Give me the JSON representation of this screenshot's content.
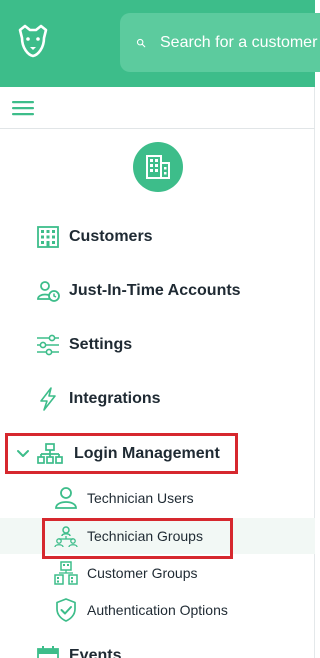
{
  "header": {
    "search_placeholder": "Search for a customer",
    "logo_icon": "cheetah-logo-icon",
    "search_icon": "search-icon"
  },
  "sidebar": {
    "menu_icon": "hamburger-menu-icon",
    "org_icon": "building-icon",
    "items": [
      {
        "label": "Customers",
        "icon": "building-grid-icon"
      },
      {
        "label": "Just-In-Time Accounts",
        "icon": "user-clock-icon"
      },
      {
        "label": "Settings",
        "icon": "sliders-icon"
      },
      {
        "label": "Integrations",
        "icon": "lightning-icon"
      },
      {
        "label": "Login Management",
        "icon": "org-chart-icon",
        "expanded": true
      },
      {
        "label": "Events",
        "icon": "calendar-icon"
      }
    ],
    "login_management_children": [
      {
        "label": "Technician Users",
        "icon": "user-icon"
      },
      {
        "label": "Technician Groups",
        "icon": "user-group-icon",
        "active": true
      },
      {
        "label": "Customer Groups",
        "icon": "building-group-icon"
      },
      {
        "label": "Authentication Options",
        "icon": "shield-check-icon"
      }
    ]
  },
  "colors": {
    "brand": "#3dbd8a",
    "search_bg": "#5ccb9e",
    "highlight_outline": "#d6282e",
    "text": "#1f2a33",
    "active_row_bg": "#f2f8f5"
  }
}
